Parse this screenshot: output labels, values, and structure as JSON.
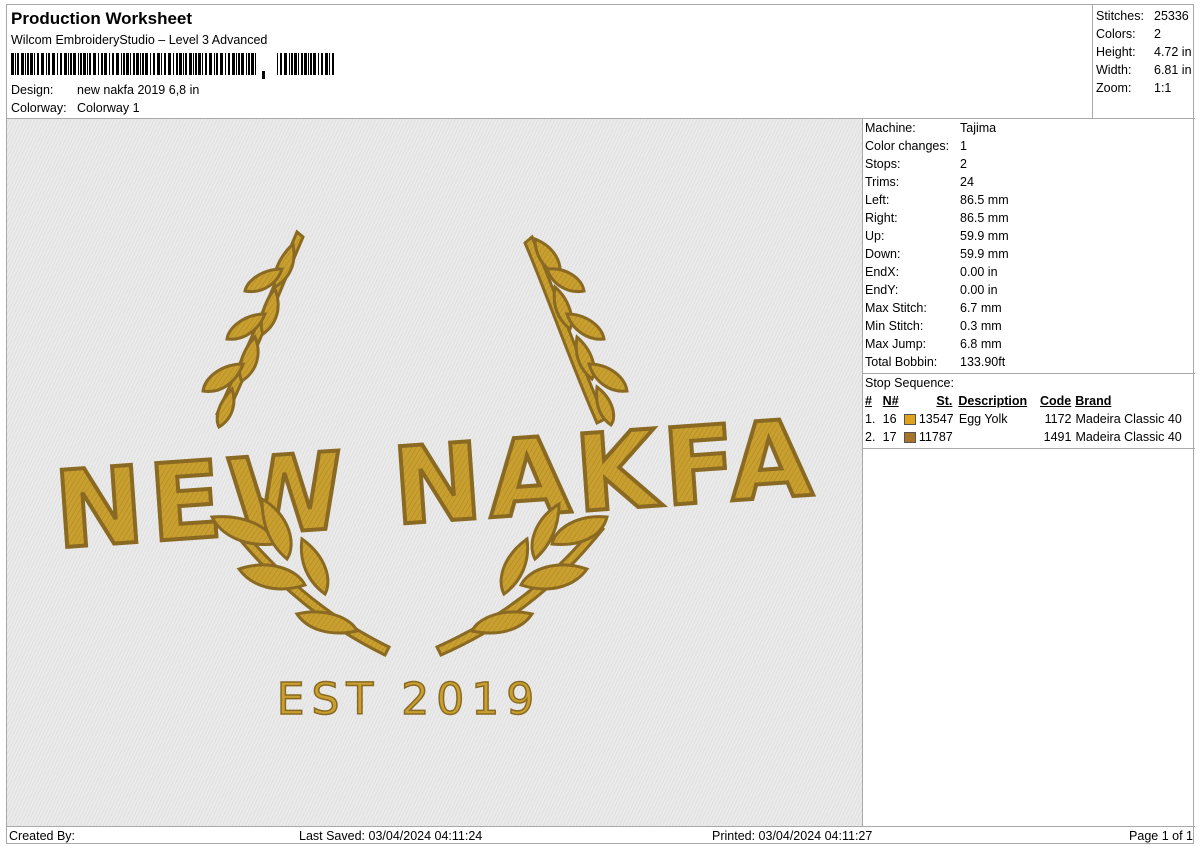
{
  "header": {
    "title": "Production Worksheet",
    "software": "Wilcom EmbroideryStudio – Level 3 Advanced",
    "design_label": "Design:",
    "design_value": "new nakfa 2019 6,8 in",
    "colorway_label": "Colorway:",
    "colorway_value": "Colorway 1"
  },
  "stats": [
    {
      "label": "Stitches:",
      "value": "25336"
    },
    {
      "label": "Colors:",
      "value": "2"
    },
    {
      "label": "Height:",
      "value": "4.72 in"
    },
    {
      "label": "Width:",
      "value": "6.81 in"
    },
    {
      "label": "Zoom:",
      "value": "1:1"
    }
  ],
  "machine_info": [
    {
      "label": "Machine:",
      "value": "Tajima"
    },
    {
      "label": "Color changes:",
      "value": "1"
    },
    {
      "label": "Stops:",
      "value": "2"
    },
    {
      "label": "Trims:",
      "value": "24"
    },
    {
      "label": "Left:",
      "value": "86.5 mm"
    },
    {
      "label": "Right:",
      "value": "86.5 mm"
    },
    {
      "label": "Up:",
      "value": "59.9 mm"
    },
    {
      "label": "Down:",
      "value": "59.9 mm"
    },
    {
      "label": "EndX:",
      "value": "0.00 in"
    },
    {
      "label": "EndY:",
      "value": "0.00 in"
    },
    {
      "label": "Max Stitch:",
      "value": "6.7 mm"
    },
    {
      "label": "Min Stitch:",
      "value": "0.3 mm"
    },
    {
      "label": "Max Jump:",
      "value": "6.8 mm"
    },
    {
      "label": "Total Bobbin:",
      "value": "133.90ft"
    }
  ],
  "stop_sequence": {
    "label": "Stop Sequence:",
    "columns": {
      "num": "#",
      "n": "N#",
      "st": "St.",
      "description": "Description",
      "code": "Code",
      "brand": "Brand"
    },
    "rows": [
      {
        "num": "1.",
        "n": "16",
        "color": "#e0a21a",
        "st": "13547",
        "description": "Egg Yolk",
        "code": "1172",
        "brand": "Madeira Classic 40"
      },
      {
        "num": "2.",
        "n": "17",
        "color": "#a8742a",
        "st": "11787",
        "description": "",
        "code": "1491",
        "brand": "Madeira Classic 40"
      }
    ]
  },
  "design": {
    "main_text": "NEW NAKFA",
    "sub_text": "EST 2019",
    "fill_color": "#c9a030",
    "outline_color": "#8a6a22"
  },
  "footer": {
    "created_by": "Created By:",
    "last_saved": "Last Saved: 03/04/2024 04:11:24",
    "printed": "Printed: 03/04/2024 04:11:27",
    "page": "Page 1 of 1"
  }
}
